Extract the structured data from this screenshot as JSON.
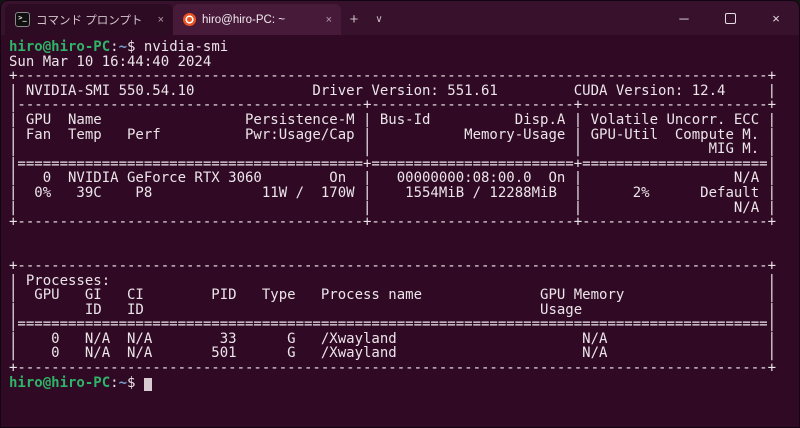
{
  "colors": {
    "terminal-bg": "#300a24",
    "titlebar-bg": "#38122c",
    "tab-inactive-bg": "#2d0b22",
    "tab-active-bg": "#471a39",
    "tab-text": "#d4c4ce",
    "tab-text-active": "#f2eaef",
    "text": "#ebe4e9",
    "prompt-green": "#2eb368",
    "path-blue": "#729fcf",
    "cursor": "#d6ccd2",
    "accent-orange": "#e95420"
  },
  "titlebar": {
    "tabs": [
      {
        "label": "コマンド プロンプト",
        "icon": "cmd-icon"
      },
      {
        "label": "hiro@hiro-PC: ~",
        "icon": "ubuntu-icon"
      }
    ],
    "new_tab": "+",
    "dropdown": "∨",
    "minimize": "─",
    "close": "×",
    "tab_close": "×"
  },
  "icons": {
    "cmd_glyph": ">_"
  },
  "terminal": {
    "prompt_user": "hiro@hiro-PC",
    "prompt_colon": ":",
    "prompt_path": "~",
    "prompt_dollar": "$",
    "command": "nvidia-smi",
    "date_line": "Sun Mar 10 16:44:40 2024",
    "output_lines": [
      "+-----------------------------------------------------------------------------------------+",
      "| NVIDIA-SMI 550.54.10              Driver Version: 551.61         CUDA Version: 12.4     |",
      "|-----------------------------------------+------------------------+----------------------+",
      "| GPU  Name                 Persistence-M | Bus-Id          Disp.A | Volatile Uncorr. ECC |",
      "| Fan  Temp   Perf          Pwr:Usage/Cap |           Memory-Usage | GPU-Util  Compute M. |",
      "|                                         |                        |               MIG M. |",
      "|=========================================+========================+======================|",
      "|   0  NVIDIA GeForce RTX 3060        On  |   00000000:08:00.0  On |                  N/A |",
      "|  0%   39C    P8             11W /  170W |    1554MiB / 12288MiB  |      2%      Default |",
      "|                                         |                        |                  N/A |",
      "+-----------------------------------------+------------------------+----------------------+",
      "",
      "",
      "+-----------------------------------------------------------------------------------------+",
      "| Processes:                                                                              |",
      "|  GPU   GI   CI        PID   Type   Process name              GPU Memory                 |",
      "|        ID   ID                                               Usage                      |",
      "|=========================================================================================|",
      "|    0   N/A  N/A        33      G   /Xwayland                      N/A                   |",
      "|    0   N/A  N/A       501      G   /Xwayland                      N/A                   |",
      "+-----------------------------------------------------------------------------------------+",
      ""
    ]
  }
}
